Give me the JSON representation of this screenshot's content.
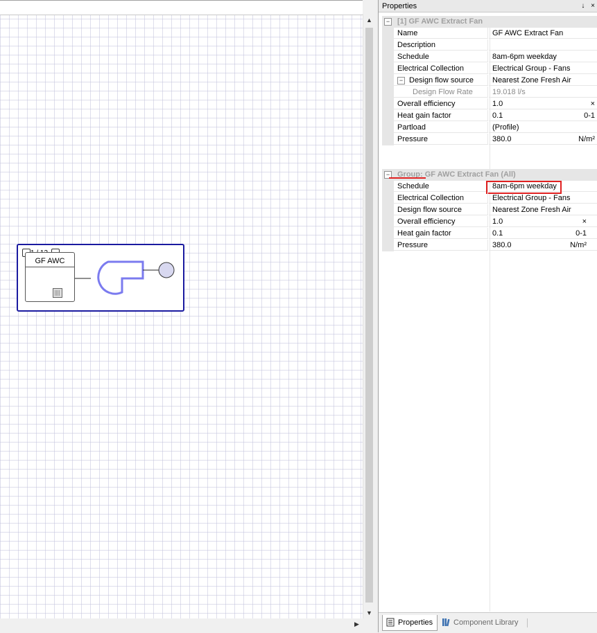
{
  "panel": {
    "title": "Properties",
    "pin_glyph": "↓",
    "close_glyph": "×"
  },
  "component": {
    "count": "1 / 12",
    "title": "GF AWC"
  },
  "section1": {
    "title": "[1] GF AWC Extract Fan",
    "rows": [
      {
        "name": "Name",
        "value": "GF AWC Extract Fan",
        "unit": ""
      },
      {
        "name": "Description",
        "value": "",
        "unit": ""
      },
      {
        "name": "Schedule",
        "value": "8am-6pm weekday",
        "unit": ""
      },
      {
        "name": "Electrical Collection",
        "value": "Electrical Group - Fans",
        "unit": ""
      },
      {
        "name": "Design flow source",
        "value": "Nearest Zone Fresh Air",
        "unit": ""
      },
      {
        "name": "Design Flow Rate",
        "value": "19.018 l/s",
        "unit": ""
      },
      {
        "name": "Overall efficiency",
        "value": "1.0",
        "unit": "×"
      },
      {
        "name": "Heat gain factor",
        "value": "0.1",
        "unit": "0-1"
      },
      {
        "name": "Partload",
        "value": "(Profile)",
        "unit": ""
      },
      {
        "name": "Pressure",
        "value": "380.0",
        "unit": "N/m²"
      }
    ]
  },
  "section2": {
    "title": "Group: GF AWC Extract Fan (All)",
    "rows": [
      {
        "name": "Schedule",
        "value": "8am-6pm weekday",
        "unit": ""
      },
      {
        "name": "Electrical Collection",
        "value": "Electrical Group - Fans",
        "unit": ""
      },
      {
        "name": "Design flow source",
        "value": "Nearest Zone Fresh Air",
        "unit": ""
      },
      {
        "name": "Overall efficiency",
        "value": "1.0",
        "unit": "×"
      },
      {
        "name": "Heat gain factor",
        "value": "0.1",
        "unit": "0-1"
      },
      {
        "name": "Pressure",
        "value": "380.0",
        "unit": "N/m²"
      }
    ]
  },
  "tabs": [
    {
      "label": "Properties",
      "icon": "properties-icon"
    },
    {
      "label": "Component Library",
      "icon": "library-icon"
    }
  ],
  "toggle_glyph": "−",
  "scroll": {
    "up": "▲",
    "down": "▼",
    "right": "▶"
  },
  "colors": {
    "highlight": "#e02020",
    "fan_outline": "#7b7bef",
    "component_border": "#1a1aa0"
  }
}
